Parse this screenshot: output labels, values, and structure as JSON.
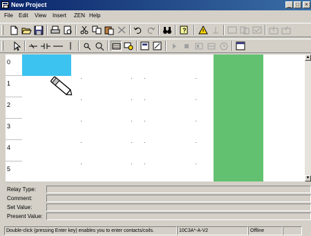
{
  "window": {
    "title": "New Project",
    "minimize_glyph": "_",
    "maximize_glyph": "□",
    "close_glyph": "×"
  },
  "menu": [
    {
      "label": "File"
    },
    {
      "label": "Edit"
    },
    {
      "label": "View"
    },
    {
      "label": "Insert"
    },
    {
      "label": "ZEN"
    },
    {
      "label": "Help"
    }
  ],
  "ladder": {
    "rows": [
      "0",
      "1",
      "2",
      "3",
      "4",
      "5"
    ]
  },
  "properties": {
    "relay_type_label": "Relay Type:",
    "comment_label": "Comment:",
    "set_value_label": "Set Value:",
    "present_value_label": "Present Value:",
    "relay_type_value": "",
    "comment_value": "",
    "set_value_value": "",
    "present_value_value": ""
  },
  "status": {
    "hint": "Double-click (pressing Enter key) enables you to enter contacts/coils.",
    "device": "10C3A*-A-V2",
    "mode": "Offline"
  },
  "colors": {
    "title_bar": "#0a246a",
    "selected_cell": "#3cc3f0",
    "power_rail": "#62c170",
    "chrome": "#d4d0c8"
  }
}
